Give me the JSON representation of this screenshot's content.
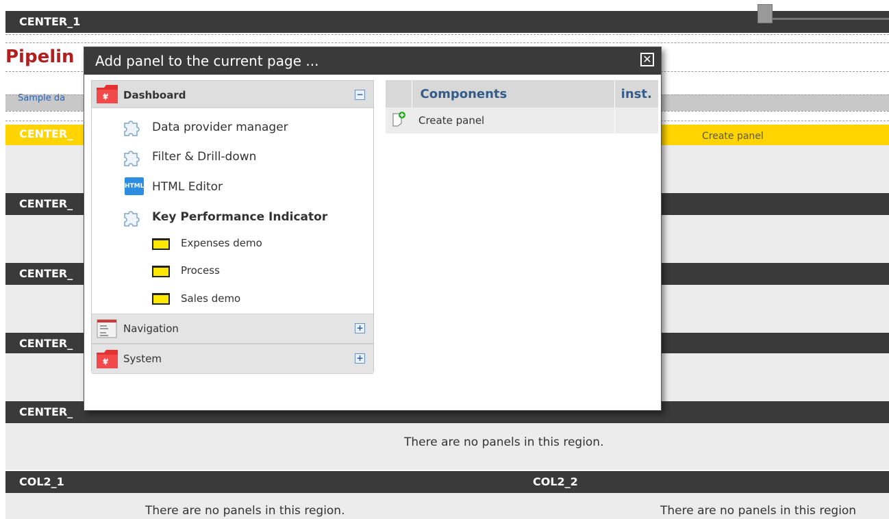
{
  "page": {
    "region_center_1": "CENTER_1",
    "page_title": "Pipelin",
    "sample_link": "Sample da",
    "region_center_2": "CENTER_",
    "region_center_3": "CENTER_",
    "region_center_4": "CENTER_",
    "region_center_5": "CENTER_",
    "region_center_6": "CENTER_",
    "yellow_create_panel": "Create panel",
    "region_col2_1": "COL2_1",
    "region_col2_2": "COL2_2",
    "empty_center": "There are no panels in this region.",
    "empty_col2_1": "There are no panels in this region.",
    "empty_col2_2": "There are no panels in this region"
  },
  "modal": {
    "title": "Add panel to the current page ...",
    "close_icon": "close-icon",
    "tree": {
      "dashboard": {
        "label": "Dashboard",
        "toggle": "−",
        "items": [
          {
            "label": "Data provider manager",
            "icon": "puzzle-icon"
          },
          {
            "label": "Filter & Drill-down",
            "icon": "puzzle-icon"
          },
          {
            "label": "HTML Editor",
            "icon": "html-icon",
            "icon_text": "HTML"
          },
          {
            "label": "Key Performance Indicator",
            "icon": "puzzle-icon"
          }
        ],
        "kpi_children": [
          {
            "label": "Expenses demo"
          },
          {
            "label": "Process"
          },
          {
            "label": "Sales demo"
          }
        ]
      },
      "navigation": {
        "label": "Navigation",
        "toggle": "+"
      },
      "system": {
        "label": "System",
        "toggle": "+"
      }
    },
    "components": {
      "headers": [
        "",
        "Components",
        "inst."
      ],
      "rows": [
        {
          "label": "Create panel",
          "inst": ""
        }
      ]
    }
  },
  "colors": {
    "region_bar": "#3a3a3a",
    "highlight": "#ffd400",
    "title_red": "#b02020",
    "link_blue": "#2a66b8"
  }
}
